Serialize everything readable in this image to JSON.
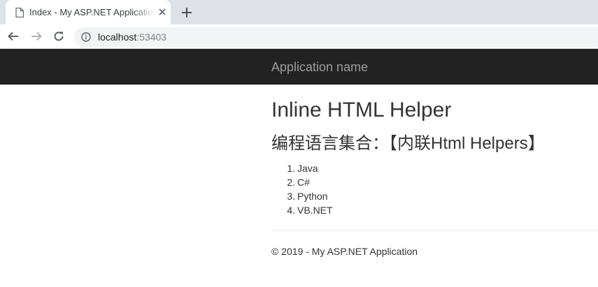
{
  "browser": {
    "tab": {
      "title": "Index - My ASP.NET Application",
      "icon": "page-icon"
    },
    "address_bar": {
      "host": "localhost",
      "port": ":53403"
    },
    "icons": {
      "back": "back-arrow-icon",
      "forward": "forward-arrow-icon",
      "reload": "reload-icon",
      "site_info": "info-icon",
      "close_tab": "close-icon",
      "new_tab": "plus-icon"
    }
  },
  "navbar": {
    "brand": "Application name",
    "background": "#222222",
    "brand_color": "#9d9d9d"
  },
  "main": {
    "title": "Inline HTML Helper",
    "subtitle": "编程语言集合：【内联Html Helpers】",
    "languages": [
      {
        "num": "1.",
        "name": "Java"
      },
      {
        "num": "2.",
        "name": "C#"
      },
      {
        "num": "3.",
        "name": "Python"
      },
      {
        "num": "4.",
        "name": "VB.NET"
      }
    ]
  },
  "footer": {
    "text": "© 2019 - My ASP.NET Application"
  }
}
